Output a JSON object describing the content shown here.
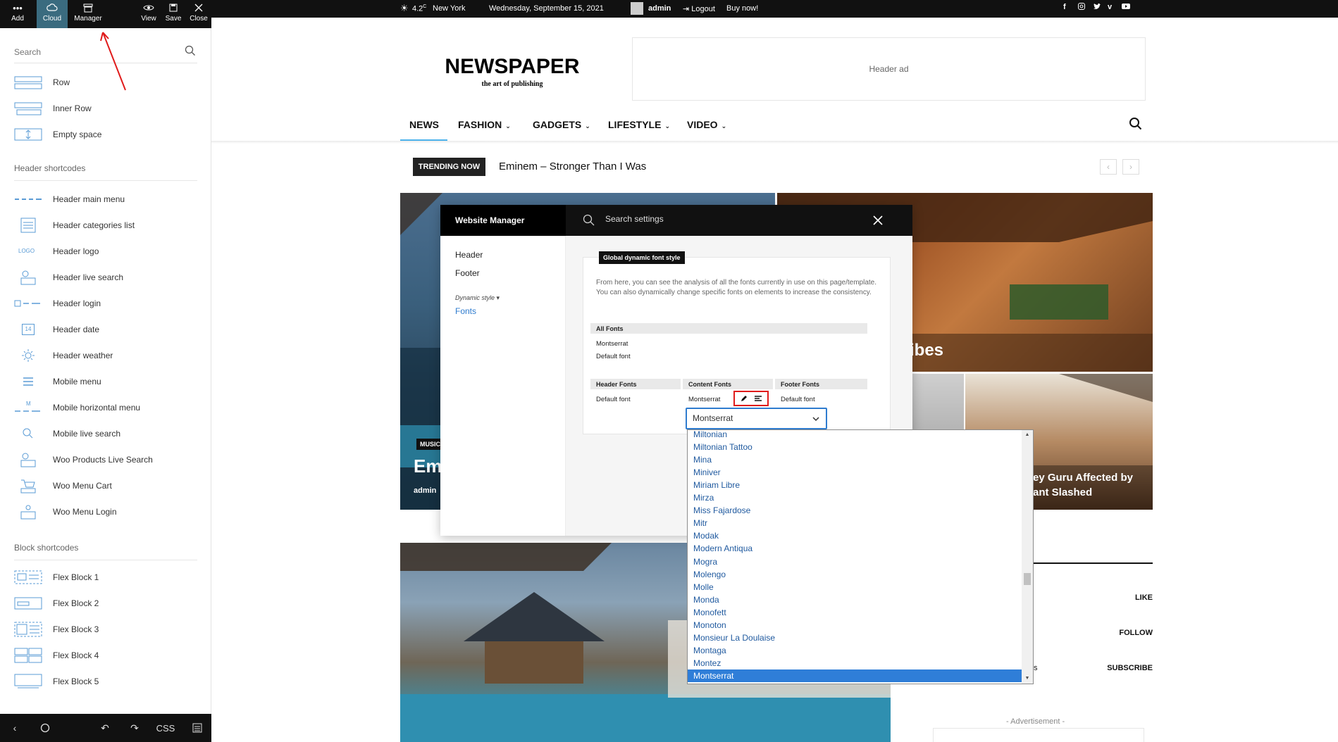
{
  "left_toolbar": {
    "buttons": [
      {
        "label": "Add",
        "icon": "dots-icon"
      },
      {
        "label": "Cloud",
        "icon": "cloud-icon"
      },
      {
        "label": "Manager",
        "icon": "manager-icon"
      },
      {
        "label": "View",
        "icon": "eye-icon"
      },
      {
        "label": "Save",
        "icon": "floppy-icon"
      },
      {
        "label": "Close",
        "icon": "close-icon"
      }
    ]
  },
  "left_panel": {
    "search_placeholder": "Search",
    "general_items": [
      "Row",
      "Inner Row",
      "Empty space"
    ],
    "header_section_title": "Header shortcodes",
    "header_items": [
      "Header main menu",
      "Header categories list",
      "Header logo",
      "Header live search",
      "Header login",
      "Header date",
      "Header weather",
      "Mobile menu",
      "Mobile horizontal menu",
      "Mobile live search",
      "Woo Products Live Search",
      "Woo Menu Cart",
      "Woo Menu Login"
    ],
    "block_section_title": "Block shortcodes",
    "block_items": [
      "Flex Block 1",
      "Flex Block 2",
      "Flex Block 3",
      "Flex Block 4",
      "Flex Block 5"
    ],
    "logo_icon_text": "LOGO",
    "date_icon_text": "14",
    "mobile_icon_text": "M",
    "bottom": {
      "css_label": "CSS"
    }
  },
  "top_bar": {
    "temperature": "4.2",
    "unit": "C",
    "city": "New York",
    "date": "Wednesday, September 15, 2021",
    "user": "admin",
    "logout": "Logout",
    "buy": "Buy now!",
    "social": [
      "facebook-icon",
      "instagram-icon",
      "twitter-icon",
      "vimeo-icon",
      "youtube-icon"
    ]
  },
  "header": {
    "logo": "NEWSPAPER",
    "tagline": "the art of publishing",
    "ad": "Header ad",
    "nav": [
      {
        "label": "NEWS",
        "dropdown": false
      },
      {
        "label": "FASHION",
        "dropdown": true
      },
      {
        "label": "GADGETS",
        "dropdown": true
      },
      {
        "label": "LIFESTYLE",
        "dropdown": true
      },
      {
        "label": "VIDEO",
        "dropdown": true
      }
    ]
  },
  "trending": {
    "label": "TRENDING NOW",
    "title": "Eminem – Stronger Than I Was",
    "prev": "‹",
    "next": "›"
  },
  "featured": {
    "music_badge": "MUSIC",
    "main_title_fragment": "Em",
    "author": "admin",
    "right_top_fragment": "ibes",
    "right_b_line1": "ey Guru Affected by",
    "right_b_line2": "ant Slashed"
  },
  "sidebar": {
    "rows": [
      "LIKE",
      "FOLLOW",
      "SUBSCRIBE"
    ],
    "fragment_s": "s",
    "ad_label": "- Advertisement -"
  },
  "website_manager": {
    "title": "Website Manager",
    "search_placeholder": "Search settings",
    "nav": [
      "Header",
      "Footer"
    ],
    "dynamic_style": "Dynamic style",
    "fonts_link": "Fonts",
    "badge": "Global dynamic font style",
    "description": "From here, you can see the analysis of all the fonts currently in use on this page/template. You can also dynamically change specific fonts on elements to increase the consistency.",
    "all_fonts_head": "All Fonts",
    "all_fonts": [
      "Montserrat",
      "Default font"
    ],
    "header_fonts_head": "Header Fonts",
    "header_fonts_value": "Default font",
    "content_fonts_head": "Content Fonts",
    "content_fonts_value": "Montserrat",
    "footer_fonts_head": "Footer Fonts",
    "footer_fonts_value": "Default font"
  },
  "font_select": {
    "selected": "Montserrat",
    "options": [
      "Miltonian",
      "Miltonian Tattoo",
      "Mina",
      "Miniver",
      "Miriam Libre",
      "Mirza",
      "Miss Fajardose",
      "Mitr",
      "Modak",
      "Modern Antiqua",
      "Mogra",
      "Molengo",
      "Molle",
      "Monda",
      "Monofett",
      "Monoton",
      "Monsieur La Doulaise",
      "Montaga",
      "Montez",
      "Montserrat"
    ]
  },
  "colors": {
    "accent": "#4db2ec",
    "active_tab": "#3a6b7f",
    "highlight_red": "#e01b1b",
    "select_blue": "#2f7ed8",
    "dark": "#111111"
  }
}
